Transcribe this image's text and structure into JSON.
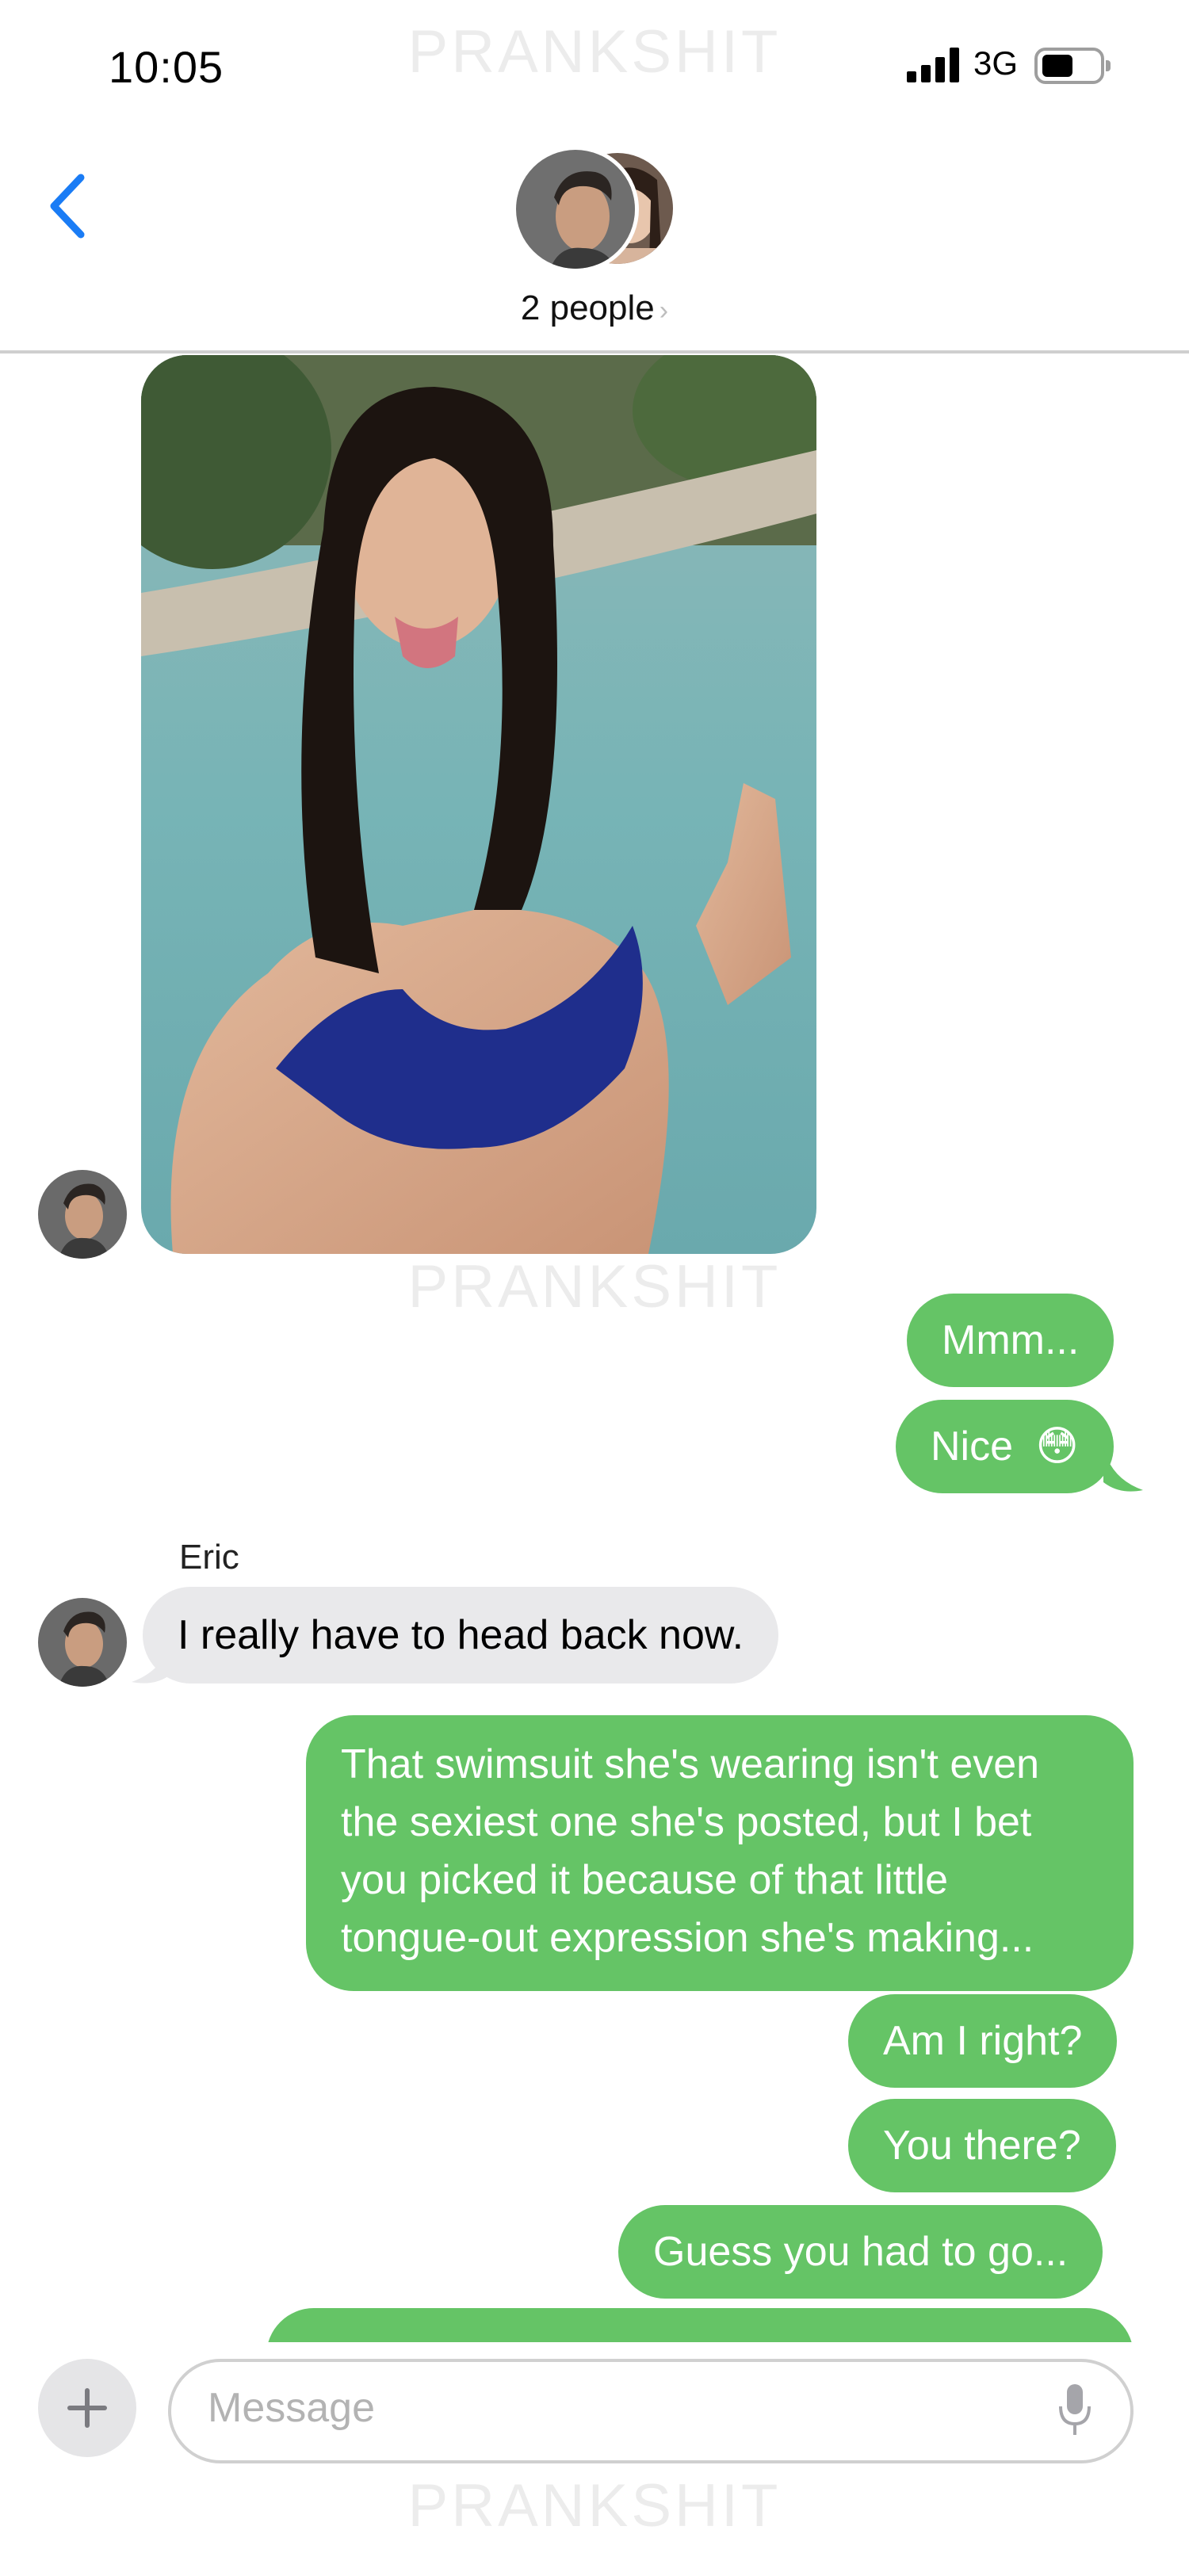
{
  "status_bar": {
    "time": "10:05",
    "network": "3G"
  },
  "watermark": "PRANKSHIT",
  "header": {
    "group_label": "2 people",
    "chevron": "›"
  },
  "messages": {
    "out_1": "Mmm...",
    "out_2": "Nice",
    "out_2_emoji": "😳",
    "sender_name": "Eric",
    "in_1": "I really have to head back now.",
    "out_3": "That swimsuit she's wearing isn't even the sexiest one she's posted, but I bet you picked it because of that little tongue-out expression she's making...",
    "out_4": "Am I right?",
    "out_5": "You there?",
    "out_6": "Guess you had to go..."
  },
  "composer": {
    "placeholder": "Message",
    "plus_icon": "plus-icon",
    "mic_icon": "mic-icon"
  },
  "colors": {
    "outgoing": "#65c466",
    "incoming": "#e9e9eb",
    "accent": "#1a7cf5"
  }
}
